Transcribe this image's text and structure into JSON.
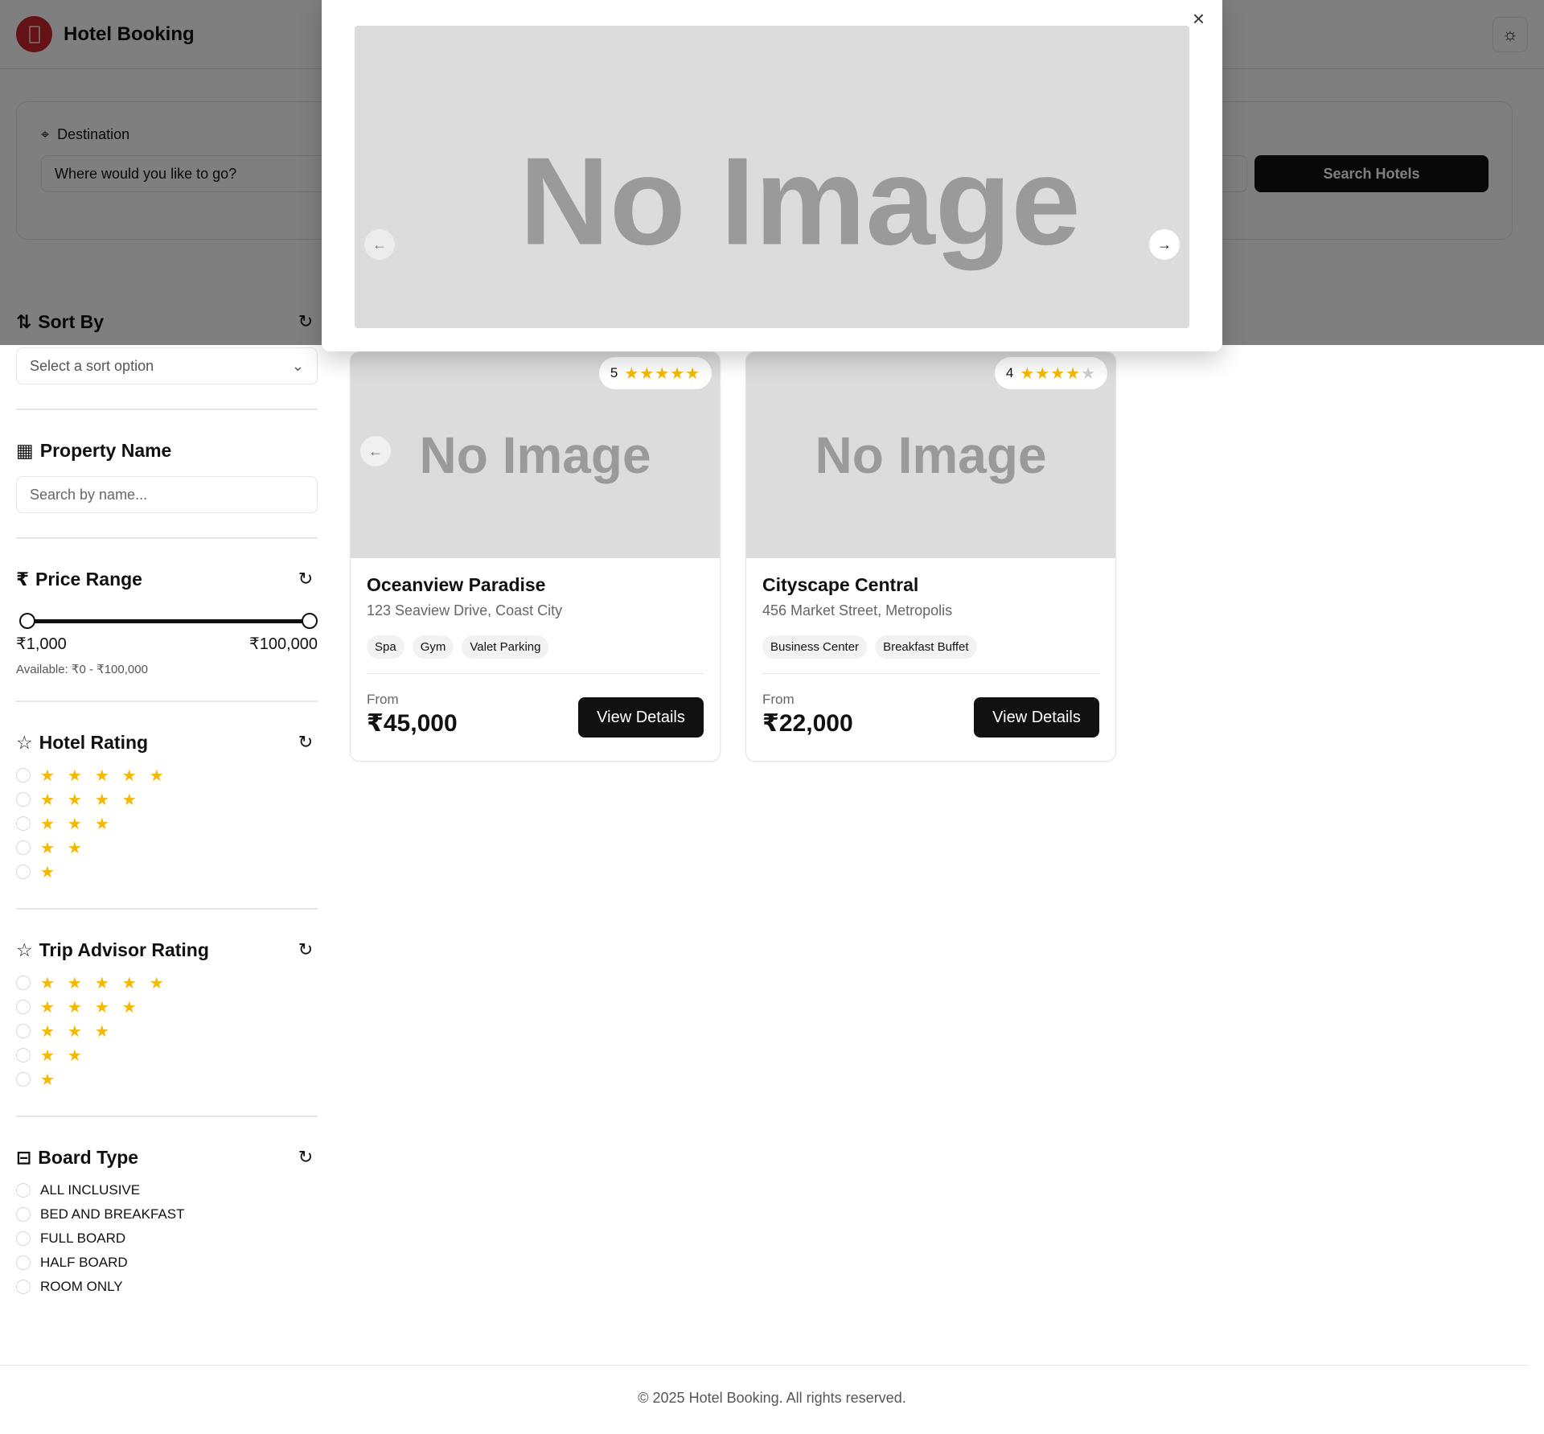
{
  "header": {
    "brand": "Hotel Booking",
    "logo_icon": "building-icon",
    "theme_icon": "sun-icon"
  },
  "search": {
    "destination_label": "Destination",
    "destination_placeholder": "Where would you like to go?",
    "search_button": "Search Hotels"
  },
  "sidebar": {
    "sort": {
      "title": "Sort By",
      "placeholder": "Select a sort option"
    },
    "property": {
      "title": "Property Name",
      "placeholder": "Search by name..."
    },
    "price": {
      "title": "Price Range",
      "currency_icon": "₹",
      "min": "₹1,000",
      "max": "₹100,000",
      "available": "Available: ₹0 - ₹100,000",
      "min_fraction": 0.01,
      "max_fraction": 1.0
    },
    "hotel_rating": {
      "title": "Hotel Rating",
      "rows": [
        5,
        4,
        3,
        2,
        1
      ]
    },
    "trip_rating": {
      "title": "Trip Advisor Rating",
      "rows": [
        5,
        4,
        3,
        2,
        1
      ]
    },
    "board": {
      "title": "Board Type",
      "options": [
        "ALL INCLUSIVE",
        "BED AND BREAKFAST",
        "FULL BOARD",
        "HALF BOARD",
        "ROOM ONLY"
      ]
    }
  },
  "results": [
    {
      "name": "Oceanview Paradise",
      "address": "123 Seaview Drive, Coast City",
      "rating": "5",
      "rating_value": 5,
      "tags": [
        "Spa",
        "Gym",
        "Valet Parking"
      ],
      "from": "From",
      "price": "₹45,000",
      "button": "View Details",
      "image_text": "No Image"
    },
    {
      "name": "Cityscape Central",
      "address": "456 Market Street, Metropolis",
      "rating": "4",
      "rating_value": 4,
      "tags": [
        "Business Center",
        "Breakfast Buffet"
      ],
      "from": "From",
      "price": "₹22,000",
      "button": "View Details",
      "image_text": "No Image"
    }
  ],
  "modal": {
    "image_text": "No Image",
    "close_icon": "close-icon"
  },
  "footer": {
    "text": "© 2025 Hotel Booking. All rights reserved."
  },
  "colors": {
    "star": "#f5b800",
    "primary": "#111111",
    "logo": "#c9252b"
  }
}
